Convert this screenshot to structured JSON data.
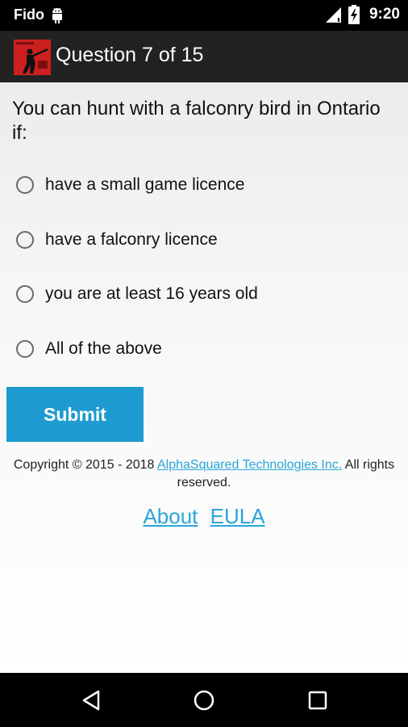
{
  "status_bar": {
    "carrier": "Fido",
    "time": "9:20",
    "icons": [
      "android-notification-icon",
      "signal-icon",
      "battery-charging-icon"
    ]
  },
  "app_bar": {
    "logo_icon": "hunter-logo-icon",
    "title": "Question 7 of 15"
  },
  "question": {
    "text": "You can hunt with a falconry bird in Ontario if:",
    "options": [
      {
        "label": "have a small game licence",
        "selected": false
      },
      {
        "label": "have a falconry licence",
        "selected": false
      },
      {
        "label": "you are at least 16 years old",
        "selected": false
      },
      {
        "label": "All of the above",
        "selected": false
      }
    ]
  },
  "submit_label": "Submit",
  "footer": {
    "copyright_prefix": "Copyright © 2015 - 2018 ",
    "company_link": "AlphaSquared Technologies Inc.",
    "copyright_suffix": " All rights reserved.",
    "about_link": "About",
    "eula_link": "EULA"
  },
  "colors": {
    "accent": "#1e9bd0",
    "link": "#2aa5d8",
    "app_bar": "#222222",
    "logo": "#cc1f1f"
  },
  "nav_bar": {
    "icons": [
      "back-icon",
      "home-icon",
      "recents-icon"
    ]
  }
}
